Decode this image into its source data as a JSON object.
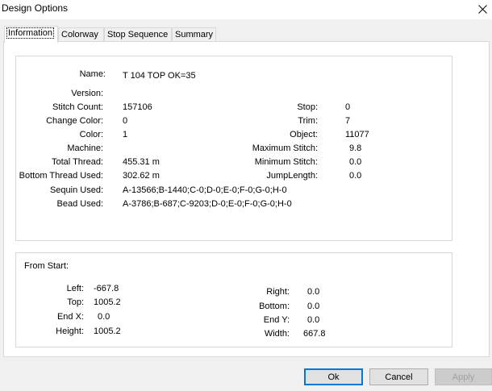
{
  "window": {
    "title": "Design Options"
  },
  "tabs": [
    {
      "label": "Information"
    },
    {
      "label": "Colorway"
    },
    {
      "label": "Stop Sequence"
    },
    {
      "label": "Summary"
    }
  ],
  "info": {
    "name_label": "Name:",
    "name_value": "T 104 TOP OK=35",
    "version_label": "Version:",
    "version_value": "",
    "stitch_count_label": "Stitch Count:",
    "stitch_count_value": "157106",
    "change_color_label": "Change Color:",
    "change_color_value": "0",
    "color_label": "Color:",
    "color_value": "1",
    "machine_label": "Machine:",
    "machine_value": "",
    "total_thread_label": "Total Thread:",
    "total_thread_value": "455.31 m",
    "bottom_thread_label": "Bottom Thread Used:",
    "bottom_thread_value": "302.62 m",
    "sequin_label": "Sequin Used:",
    "sequin_value": "A-13566;B-1440;C-0;D-0;E-0;F-0;G-0;H-0",
    "bead_label": "Bead Used:",
    "bead_value": "A-3786;B-687;C-9203;D-0;E-0;F-0;G-0;H-0",
    "stop_label": "Stop:",
    "stop_value": "0",
    "trim_label": "Trim:",
    "trim_value": "7",
    "object_label": "Object:",
    "object_value": "11077",
    "max_stitch_label": "Maximum Stitch:",
    "max_stitch_value": "9.8",
    "min_stitch_label": "Minimum Stitch:",
    "min_stitch_value": "0.0",
    "jump_length_label": "JumpLength:",
    "jump_length_value": "0.0"
  },
  "extents": {
    "heading": "From Start:",
    "left_label": "Left:",
    "left_value": "-667.8",
    "top_label": "Top:",
    "top_value": "1005.2",
    "end_x_label": "End X:",
    "end_x_value": "0.0",
    "height_label": "Height:",
    "height_value": "1005.2",
    "right_label": "Right:",
    "right_value": "0.0",
    "bottom_label": "Bottom:",
    "bottom_value": "0.0",
    "end_y_label": "End Y:",
    "end_y_value": "0.0",
    "width_label": "Width:",
    "width_value": "667.8"
  },
  "buttons": {
    "ok": "Ok",
    "cancel": "Cancel",
    "apply": "Apply"
  },
  "colors": {
    "accent": "#0078d7",
    "dialog_bg": "#f0f0f0"
  }
}
